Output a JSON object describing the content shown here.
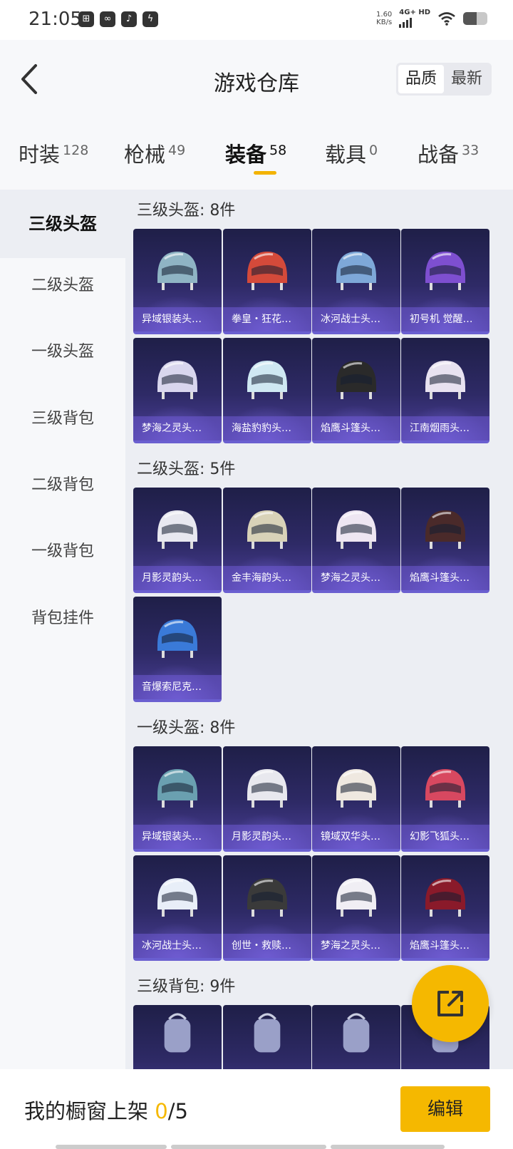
{
  "status_bar": {
    "time": "21:05",
    "net_speed": "1.60",
    "net_unit": "KB/s",
    "network": "4G+ HD",
    "battery_level": 0.55
  },
  "header": {
    "title": "游戏仓库",
    "sort_options": [
      "品质",
      "最新"
    ],
    "sort_selected": "品质"
  },
  "tabs": [
    {
      "label": "时装",
      "count": "128"
    },
    {
      "label": "枪械",
      "count": "49"
    },
    {
      "label": "装备",
      "count": "58",
      "active": true
    },
    {
      "label": "载具",
      "count": "0"
    },
    {
      "label": "战备",
      "count": "33"
    }
  ],
  "sidebar": {
    "items": [
      "三级头盔",
      "二级头盔",
      "一级头盔",
      "三级背包",
      "二级背包",
      "一级背包",
      "背包挂件"
    ],
    "active": "三级头盔"
  },
  "sections": [
    {
      "title": "三级头盔: 8件",
      "items": [
        "异域银装头…",
        "拳皇・狂花…",
        "冰河战士头…",
        "初号机 觉醒…",
        "梦海之灵头…",
        "海盐豹豹头…",
        "焰鹰斗篷头…",
        "江南烟雨头…"
      ]
    },
    {
      "title": "二级头盔: 5件",
      "items": [
        "月影灵韵头…",
        "金丰海韵头…",
        "梦海之灵头…",
        "焰鹰斗篷头…",
        "音爆索尼克…"
      ]
    },
    {
      "title": "一级头盔: 8件",
      "items": [
        "异域银装头…",
        "月影灵韵头…",
        "镜域双华头…",
        "幻影飞狐头…",
        "冰河战士头…",
        "创世・救赎…",
        "梦海之灵头…",
        "焰鹰斗篷头…"
      ]
    },
    {
      "title": "三级背包: 9件",
      "items": []
    }
  ],
  "bottom_bar": {
    "label": "我的橱窗上架",
    "current": "0",
    "separator": "/",
    "total": "5",
    "edit_label": "编辑"
  },
  "colors": {
    "accent": "#f5b800",
    "card_bg": "#2e2a66",
    "card_border": "#6a5fd0"
  }
}
